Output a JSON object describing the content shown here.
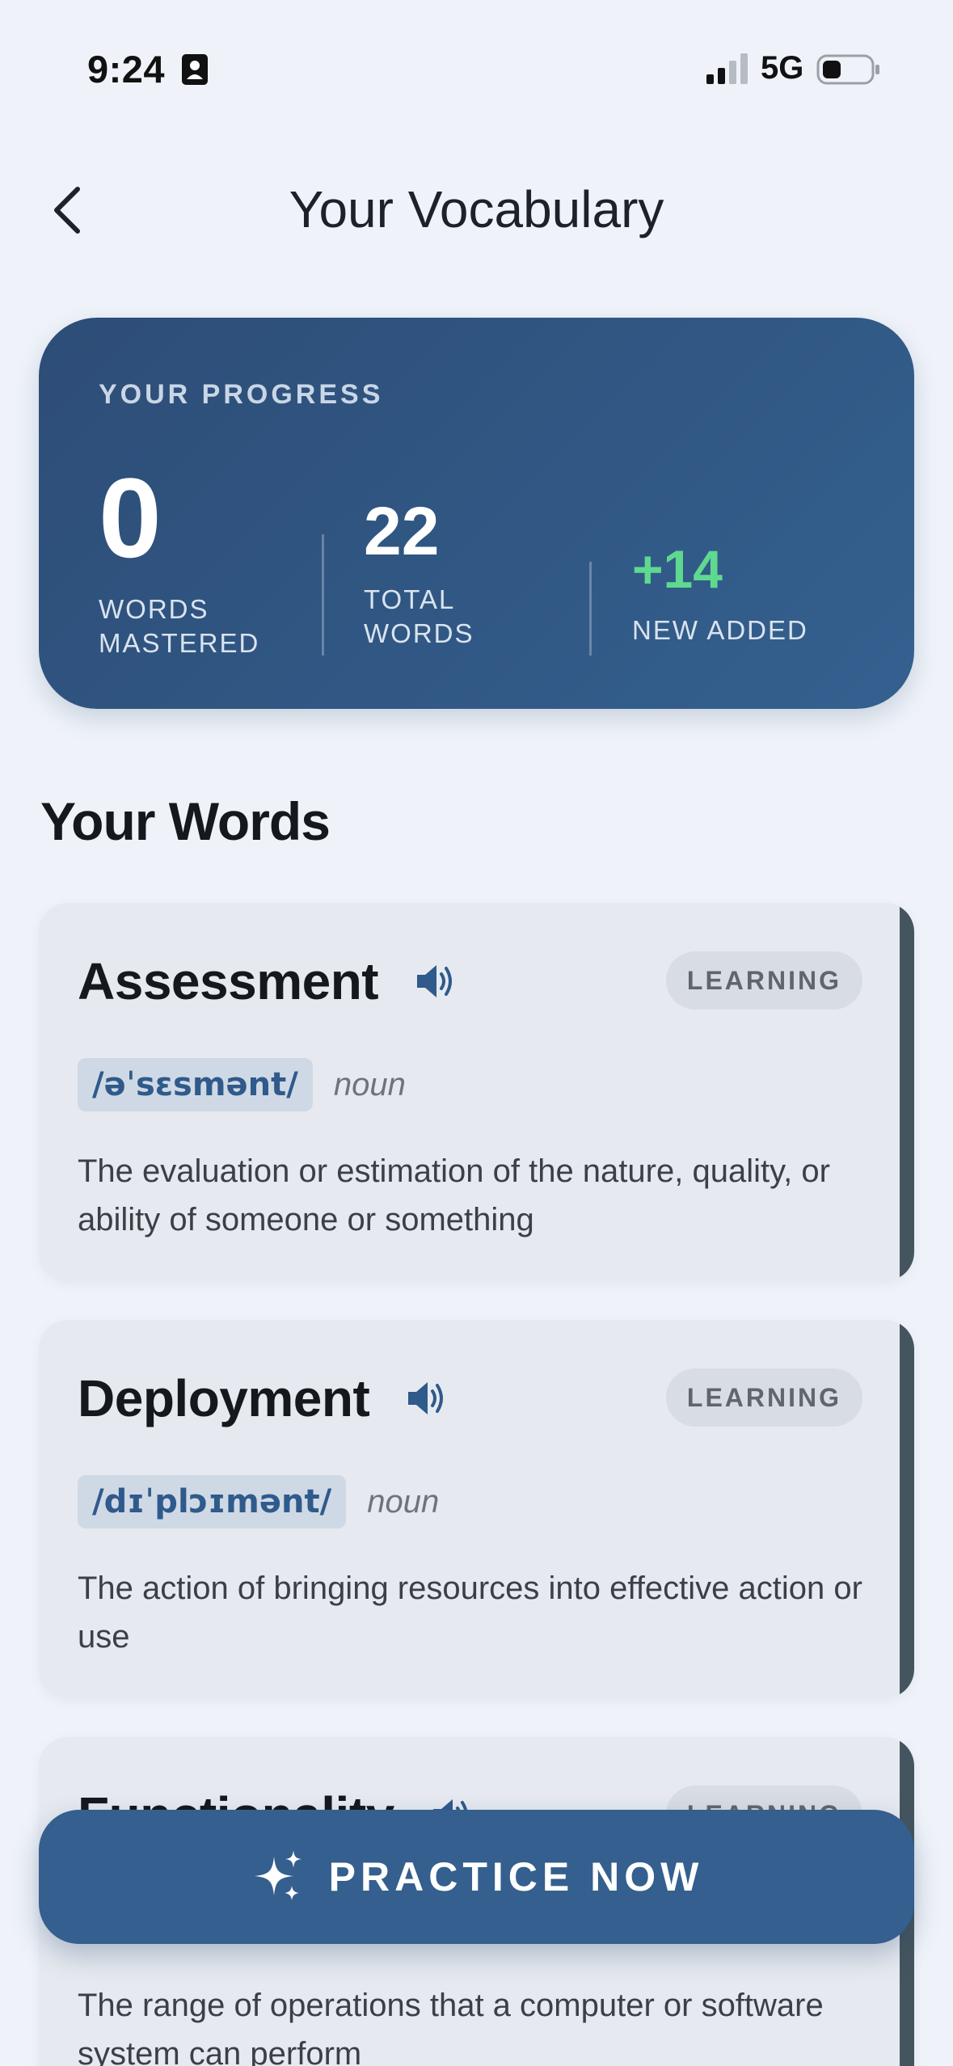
{
  "status_bar": {
    "time": "9:24",
    "network": "5G"
  },
  "header": {
    "title": "Your Vocabulary"
  },
  "progress": {
    "label": "YOUR PROGRESS",
    "mastered": {
      "value": "0",
      "caption_1": "WORDS",
      "caption_2": "MASTERED"
    },
    "total": {
      "value": "22",
      "caption_1": "TOTAL",
      "caption_2": "WORDS"
    },
    "new_added": {
      "value": "+14",
      "caption_1": "NEW ADDED"
    }
  },
  "words_section": {
    "title": "Your Words"
  },
  "words": [
    {
      "word": "Assessment",
      "status": "LEARNING",
      "phonetic": "/əˈsɛsmənt/",
      "pos": "noun",
      "definition": "The evaluation or estimation of the nature, quality, or ability of someone or something"
    },
    {
      "word": "Deployment",
      "status": "LEARNING",
      "phonetic": "/dɪˈplɔɪmənt/",
      "pos": "noun",
      "definition": "The action of bringing resources into effective action or use"
    },
    {
      "word": "Functionality",
      "status": "LEARNING",
      "phonetic": "",
      "pos": "",
      "definition": "The range of operations that a computer or software system can perform"
    }
  ],
  "practice_button": {
    "label": "PRACTICE NOW"
  },
  "icons": {
    "back": "chevron-left-icon",
    "speaker": "speaker-icon",
    "sparkle": "sparkle-icon"
  },
  "colors": {
    "accent": "#345f8e",
    "progress_new": "#5fd98f",
    "phonetic_text": "#2f5a8b"
  }
}
